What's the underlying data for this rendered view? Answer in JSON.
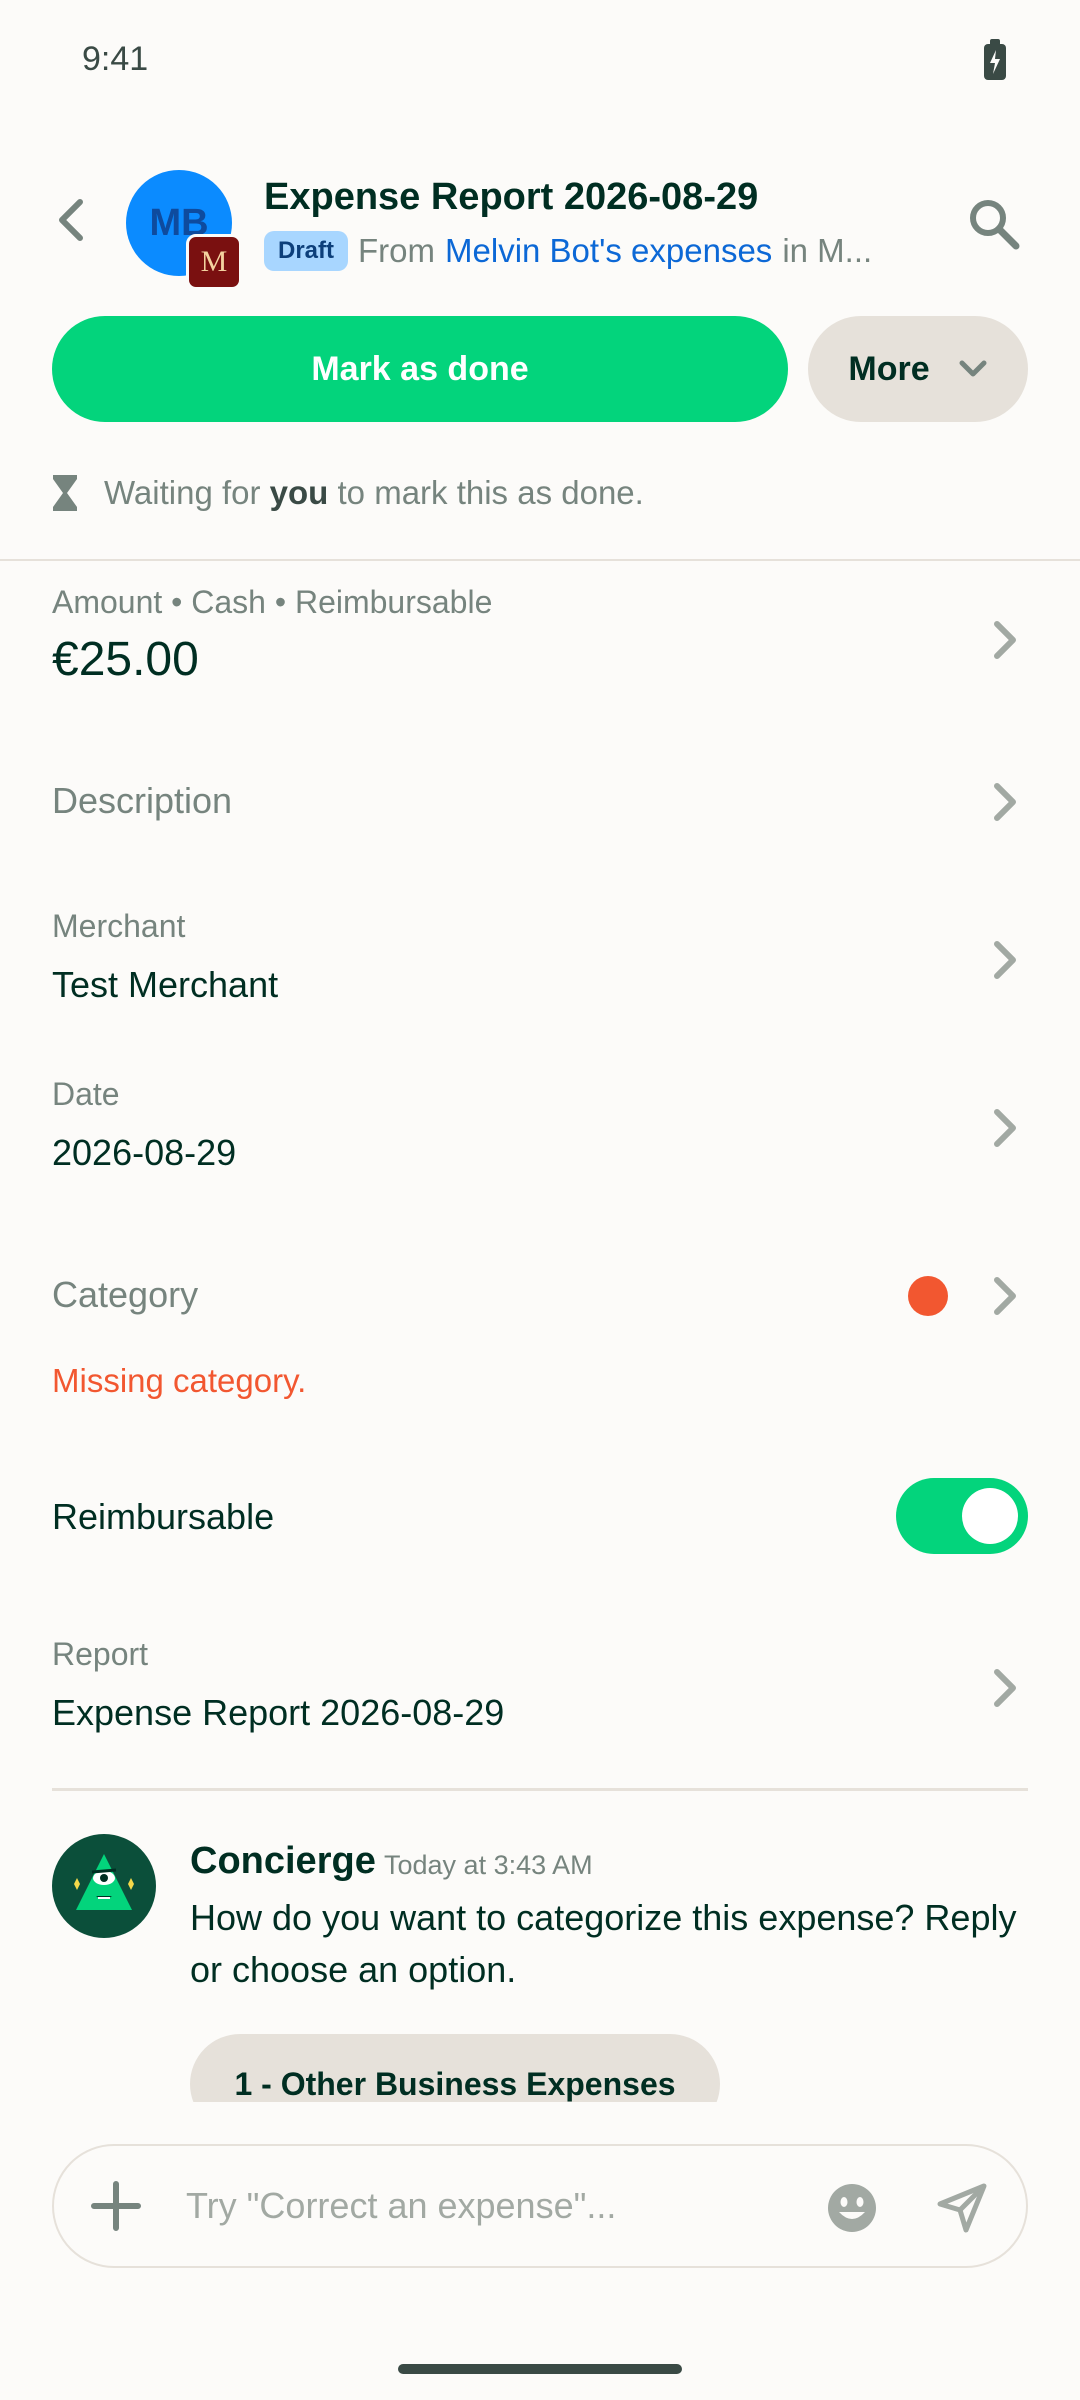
{
  "status_bar": {
    "time": "9:41"
  },
  "header": {
    "avatar_initials": "MB",
    "workspace_initial": "M",
    "title": "Expense Report 2026-08-29",
    "badge": "Draft",
    "from_prefix": "From",
    "from_link": "Melvin Bot's expenses",
    "in_text": "in M..."
  },
  "actions": {
    "primary_label": "Mark as done",
    "more_label": "More"
  },
  "waiting": {
    "prefix": "Waiting for",
    "you": "you",
    "suffix": "to mark this as done."
  },
  "fields": {
    "amount_label": "Amount • Cash • Reimbursable",
    "amount_value": "€25.00",
    "description_label": "Description",
    "merchant_label": "Merchant",
    "merchant_value": "Test Merchant",
    "date_label": "Date",
    "date_value": "2026-08-29",
    "category_label": "Category",
    "category_error": "Missing category.",
    "reimbursable_label": "Reimbursable",
    "reimbursable_on": true,
    "report_label": "Report",
    "report_value": "Expense Report 2026-08-29"
  },
  "message": {
    "sender": "Concierge",
    "timestamp": "Today at 3:43 AM",
    "text": "How do you want to categorize this expense? Reply or choose an option.",
    "option_1": "1 - Other Business Expenses"
  },
  "composer": {
    "placeholder": "Try \"Correct an expense\"..."
  },
  "colors": {
    "accent": "#03D47C",
    "error": "#F25730",
    "link": "#0C68D6"
  }
}
